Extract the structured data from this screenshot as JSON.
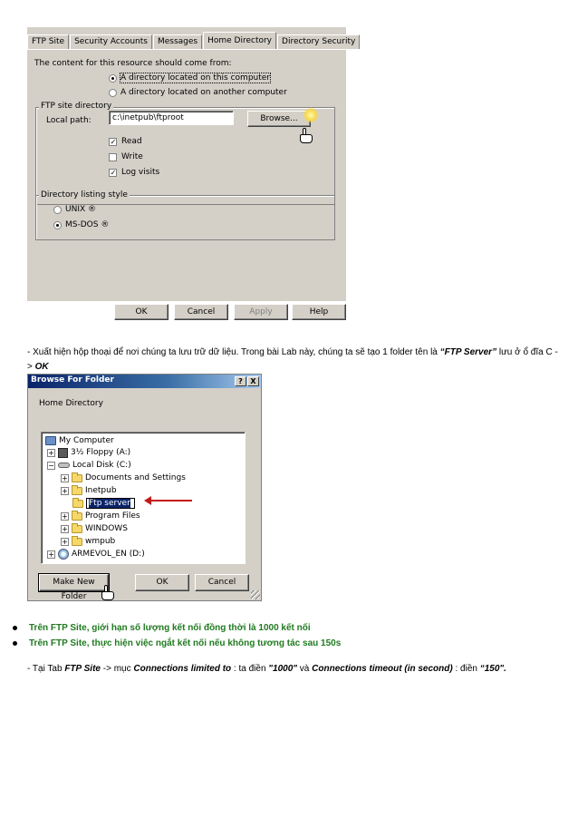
{
  "dialog1": {
    "tabs": [
      "FTP Site",
      "Security Accounts",
      "Messages",
      "Home Directory",
      "Directory Security"
    ],
    "active_tab": "Home Directory",
    "content_source_label": "The content for this resource should come from:",
    "radio_local": "A directory located on this computer",
    "radio_share": "A directory located on another computer",
    "group_ftp_dir": "FTP site directory",
    "local_path_label": "Local path:",
    "local_path_value": "c:\\inetpub\\ftproot",
    "browse_label": "Browse...",
    "read_label": "Read",
    "write_label": "Write",
    "log_label": "Log visits",
    "read_checked": true,
    "write_checked": false,
    "log_checked": true,
    "group_listing": "Directory listing style",
    "unix_label": "UNIX ®",
    "msdos_label": "MS-DOS ®",
    "ok_label": "OK",
    "cancel_label": "Cancel",
    "apply_label": "Apply",
    "help_label": "Help"
  },
  "paragraph1": {
    "prefix": "- Xuất hiện hộp thoại để nơi chúng ta lưu trữ dữ liệu. Trong bài Lab này, chúng ta sẽ tạo 1 folder tên là ",
    "folder_name": "“FTP Server”",
    "middle": " lưu ở ổ đĩa C -",
    "line2_prefix": "> ",
    "ok": "OK"
  },
  "dialog2": {
    "title": "Browse For Folder",
    "help_btn": "?",
    "close_btn": "X",
    "heading": "Home Directory",
    "tree": {
      "my_computer": "My Computer",
      "floppy": "3½ Floppy (A:)",
      "local_disk": "Local Disk (C:)",
      "documents": "Documents and Settings",
      "inetpub": "Inetpub",
      "ftp_server": "Ftp server",
      "program_files": "Program Files",
      "windows": "WINDOWS",
      "wmpub": "wmpub",
      "armevol": "ARMEVOL_EN (D:)"
    },
    "make_new_folder": "Make New Folder",
    "ok_label": "OK",
    "cancel_label": "Cancel"
  },
  "bullets": [
    "Trên FTP Site, giới hạn số lượng kết nối đồng thời là 1000 kết nối",
    "Trên FTP Site, thực hiện việc ngắt kết nối nếu không tương tác sau 150s"
  ],
  "paragraph2": {
    "p1": "- Tại Tab ",
    "tab": "FTP Site",
    "p2": " -> mục ",
    "item": "Connections limited to",
    "p3": " : ta điền ",
    "v1": "\"1000\"",
    "p4": " và ",
    "item2": "Connections timeout (in second)",
    "p5": " : điền ",
    "v2": "“150\"."
  },
  "colors": {
    "dialog_bg": "#d4d0c8",
    "titlebar": "#0a246a",
    "bullet_green": "#1f7a1f",
    "arrow_red": "#c21a1a"
  }
}
